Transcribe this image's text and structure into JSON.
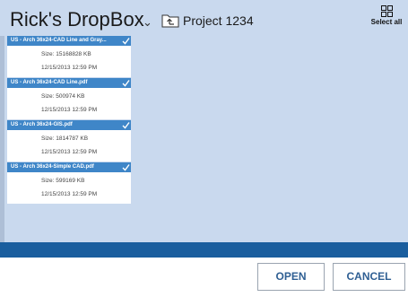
{
  "header": {
    "title": "Rick's DropBox",
    "title_caret": "⌄",
    "current_folder": "Project 1234",
    "select_all_label": "Select all"
  },
  "files": [
    {
      "name": "US - Arch 36x24-CAD Line and Gray...",
      "size": "Size: 15168828 KB",
      "date": "12/15/2013 12:59 PM",
      "selected": true
    },
    {
      "name": "US - Arch 36x24-CAD Line.pdf",
      "size": "Size: 500974 KB",
      "date": "12/15/2013 12:59 PM",
      "selected": true
    },
    {
      "name": "US - Arch 36x24-GIS.pdf",
      "size": "Size: 1814787 KB",
      "date": "12/15/2013 12:59 PM",
      "selected": true
    },
    {
      "name": "US - Arch 36x24-Simple CAD.pdf",
      "size": "Size: 599169 KB",
      "date": "12/15/2013 12:59 PM",
      "selected": true
    }
  ],
  "footer": {
    "open_label": "OPEN",
    "cancel_label": "CANCEL"
  },
  "colors": {
    "background": "#c9d9ee",
    "file_header": "#3f86c8",
    "band": "#1a5e9e",
    "button_text": "#2f5f93"
  }
}
